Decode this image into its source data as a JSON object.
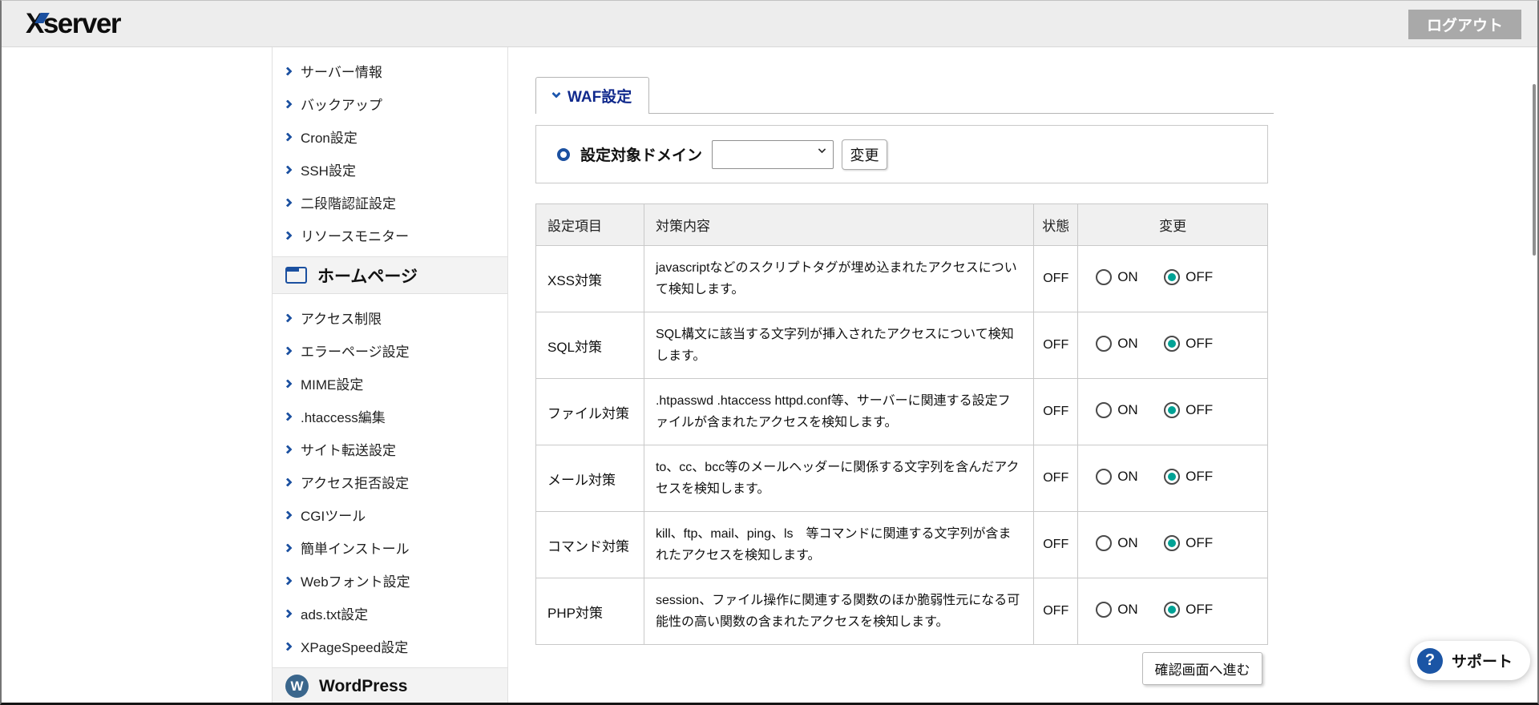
{
  "header": {
    "logo": "Xserver",
    "logout_label": "ログアウト"
  },
  "sidebar": {
    "top_items": [
      "サーバー情報",
      "バックアップ",
      "Cron設定",
      "SSH設定",
      "二段階認証設定",
      "リソースモニター"
    ],
    "sections": [
      {
        "title": "ホームページ",
        "icon": "browser-window-icon",
        "items": [
          "アクセス制限",
          "エラーページ設定",
          "MIME設定",
          ".htaccess編集",
          "サイト転送設定",
          "アクセス拒否設定",
          "CGIツール",
          "簡単インストール",
          "Webフォント設定",
          "ads.txt設定",
          "XPageSpeed設定"
        ]
      },
      {
        "title": "WordPress",
        "icon": "wordpress-icon",
        "items": []
      }
    ]
  },
  "main": {
    "tab": {
      "label": "WAF設定"
    },
    "domain_selector": {
      "label": "設定対象ドメイン",
      "select_value": "",
      "change_button": "変更"
    },
    "table": {
      "headers": [
        "設定項目",
        "対策内容",
        "状態",
        "変更"
      ],
      "radio_labels": {
        "on": "ON",
        "off": "OFF"
      },
      "rows": [
        {
          "name": "XSS対策",
          "description": "javascriptなどのスクリプトタグが埋め込まれたアクセスについて検知します。",
          "status": "OFF",
          "selected": "OFF"
        },
        {
          "name": "SQL対策",
          "description": "SQL構文に該当する文字列が挿入されたアクセスについて検知します。",
          "status": "OFF",
          "selected": "OFF"
        },
        {
          "name": "ファイル対策",
          "description": ".htpasswd .htaccess httpd.conf等、サーバーに関連する設定ファイルが含まれたアクセスを検知します。",
          "status": "OFF",
          "selected": "OFF"
        },
        {
          "name": "メール対策",
          "description": "to、cc、bcc等のメールヘッダーに関係する文字列を含んだアクセスを検知します。",
          "status": "OFF",
          "selected": "OFF"
        },
        {
          "name": "コマンド対策",
          "description": "kill、ftp、mail、ping、ls　等コマンドに関連する文字列が含まれたアクセスを検知します。",
          "status": "OFF",
          "selected": "OFF"
        },
        {
          "name": "PHP対策",
          "description": "session、ファイル操作に関連する関数のほか脆弱性元になる可能性の高い関数の含まれたアクセスを検知します。",
          "status": "OFF",
          "selected": "OFF"
        }
      ]
    },
    "submit_button": "確認画面へ進む"
  },
  "support": {
    "label": "サポート"
  },
  "icons": {
    "wordpress_w": "W",
    "question": "?"
  },
  "colors": {
    "brand-blue": "#1b50a0",
    "tab-text": "#10298c",
    "radio-selected": "#00a295",
    "topbar-bg": "#ededed",
    "logout-bg": "#a9a9a9",
    "section-bg": "#f3f3f3",
    "table-header-bg": "#f0f0f0",
    "border-gray": "#c9c9c9",
    "wordpress-blue": "#3a668c",
    "support-blue": "#1b55a5"
  }
}
